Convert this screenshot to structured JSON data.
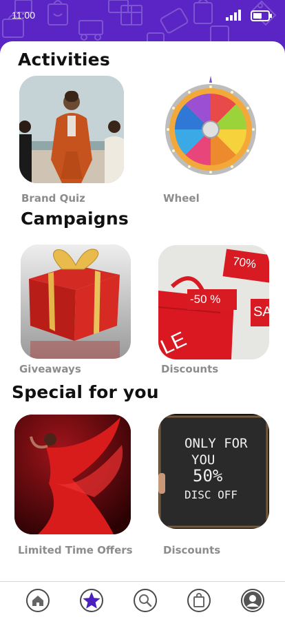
{
  "status_bar": {
    "time": "11:00"
  },
  "sections": {
    "activities": {
      "title": "Activities",
      "items": [
        {
          "label": "Brand Quiz"
        },
        {
          "label": "Wheel"
        }
      ]
    },
    "campaigns": {
      "title": "Campaigns",
      "items": [
        {
          "label": "Giveaways"
        },
        {
          "label": "Discounts",
          "tag_a": "70%",
          "tag_b": "-50 %",
          "tag_c": "SA",
          "bag_text": "LE"
        }
      ]
    },
    "special": {
      "title": "Special for you",
      "items": [
        {
          "label": "Limited Time Offers"
        },
        {
          "label": "Discounts",
          "board_line1": "ONLY FOR",
          "board_line2": "YOU",
          "board_line3": "50%",
          "board_line4": "DISC OFF"
        }
      ]
    }
  },
  "navbar": {
    "items": [
      {
        "icon": "home-icon"
      },
      {
        "icon": "star-icon",
        "active": true
      },
      {
        "icon": "search-icon"
      },
      {
        "icon": "shopping-bag-icon"
      },
      {
        "icon": "profile-icon"
      }
    ]
  },
  "colors": {
    "header": "#5a25c4",
    "active_nav": "#4b1fbf"
  }
}
